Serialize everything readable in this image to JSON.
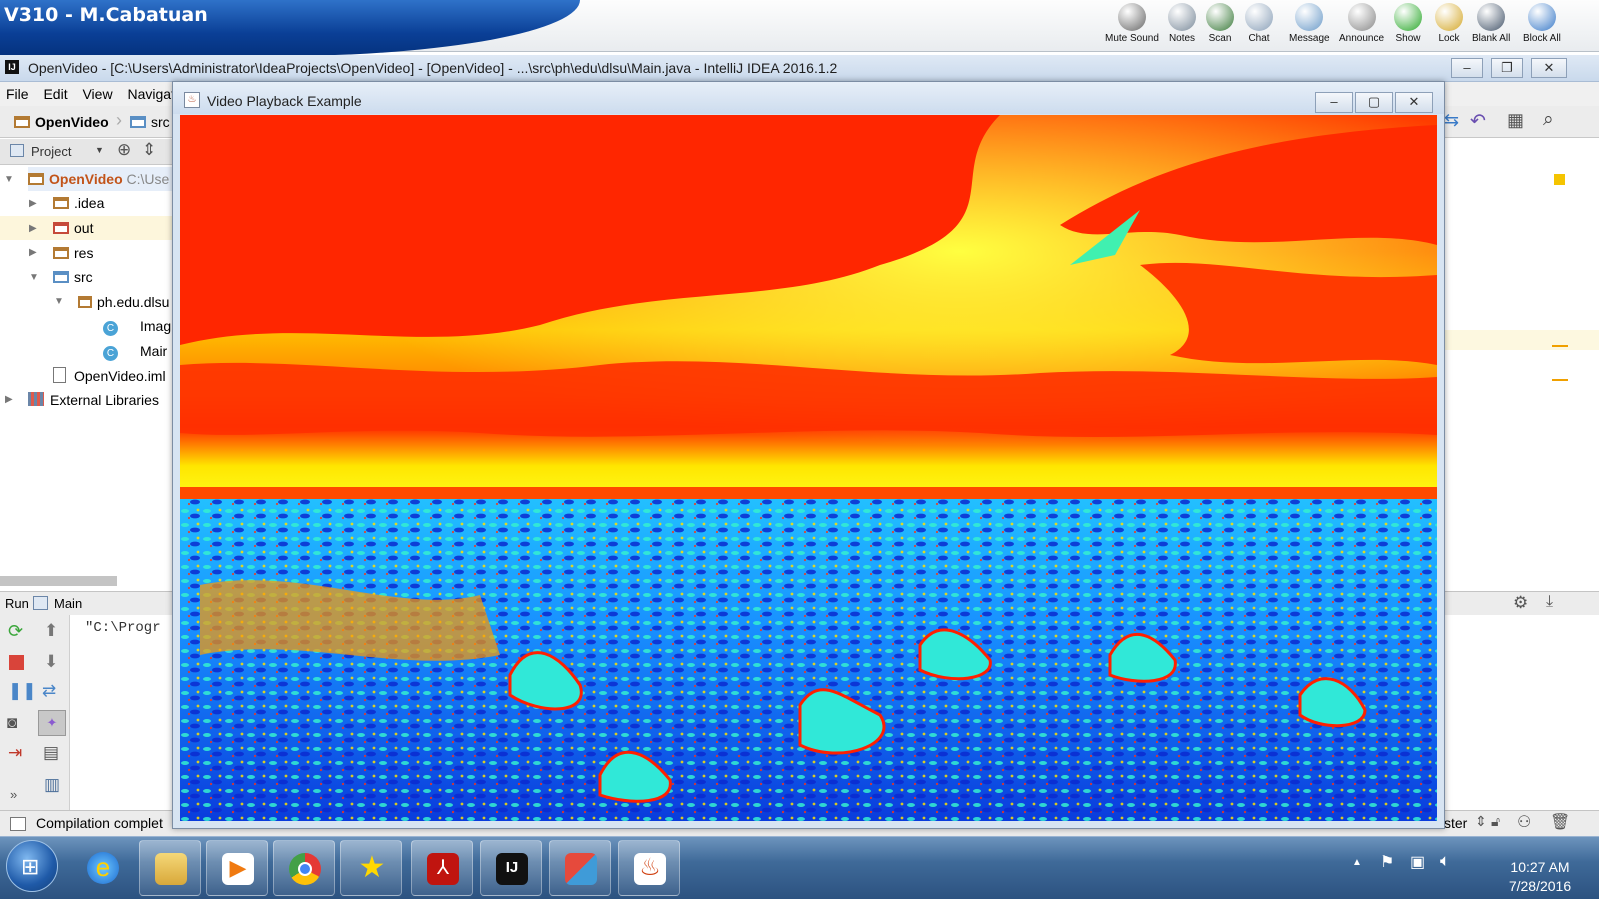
{
  "topbar": {
    "station": "V310 - M.Cabatuan",
    "buttons": [
      {
        "label": "Mute Sound",
        "icon": "speaker-icon"
      },
      {
        "label": "Notes",
        "icon": "notes-icon"
      },
      {
        "label": "Scan",
        "icon": "scan-icon"
      },
      {
        "label": "Chat",
        "icon": "chat-icon"
      },
      {
        "label": "Message",
        "icon": "message-icon"
      },
      {
        "label": "Announce",
        "icon": "announce-icon"
      },
      {
        "label": "Show",
        "icon": "play-icon"
      },
      {
        "label": "Lock",
        "icon": "lock-icon"
      },
      {
        "label": "Blank All",
        "icon": "monitor-icon"
      },
      {
        "label": "Block All",
        "icon": "globe-icon"
      }
    ]
  },
  "ide": {
    "title": "OpenVideo - [C:\\Users\\Administrator\\IdeaProjects\\OpenVideo] - [OpenVideo] - ...\\src\\ph\\edu\\dlsu\\Main.java - IntelliJ IDEA 2016.1.2",
    "logo": "IJ",
    "menu": [
      "File",
      "Edit",
      "View",
      "Navigat"
    ],
    "breadcrumb": [
      "OpenVideo",
      "src"
    ],
    "project_dropdown": "Project",
    "tree": {
      "root": "OpenVideo",
      "root_path": "C:\\Use",
      "idea": ".idea",
      "out": "out",
      "res": "res",
      "src": "src",
      "pkg": "ph.edu.dlsu",
      "class1": "Imag",
      "class2": "Mair",
      "iml": "OpenVideo.iml",
      "libs": "External Libraries"
    },
    "run_label": "Run",
    "run_config": "Main",
    "console_text": "\"C:\\Progr",
    "status": "Compilation complet",
    "status_right": "ster"
  },
  "video_window": {
    "title": "Video Playback Example"
  },
  "taskbar": {
    "time": "10:27 AM",
    "date": "7/28/2016"
  }
}
